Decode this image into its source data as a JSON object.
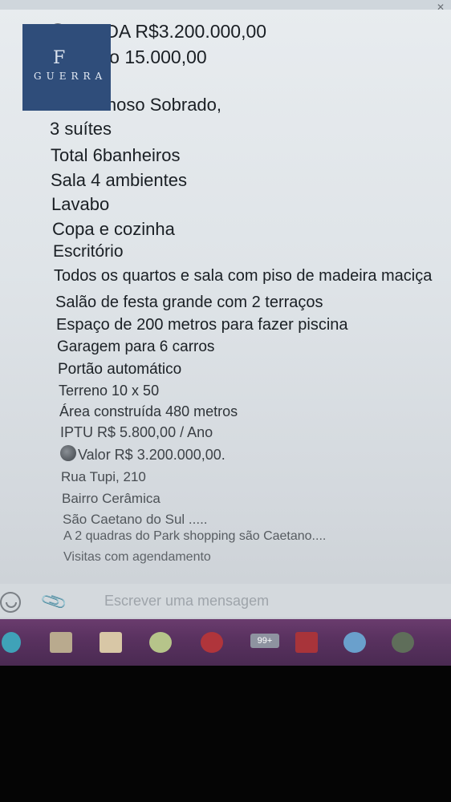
{
  "brand": {
    "logo_text": "GUERRA",
    "logo_mark": "F"
  },
  "message": {
    "lines": [
      "VENDA R$3.200.000,00",
      "Locação 15.000,00",
      "Maravilhoso Sobrado,",
      "3 suítes",
      "Total 6banheiros",
      "Sala 4 ambientes",
      "Lavabo",
      "Copa e cozinha",
      "Escritório",
      "Todos os quartos e sala com piso de madeira maciça",
      "Salão de festa grande com 2 terraços",
      "Espaço de 200 metros para fazer piscina",
      "Garagem para 6 carros",
      "Portão automático",
      "Terreno 10 x 50",
      "Área construída 480 metros",
      "IPTU R$ 5.800,00 / Ano",
      "Valor R$ 3.200.000,00.",
      "Rua Tupi, 210",
      "Bairro Cerâmica",
      "São Caetano do Sul .....",
      "A 2 quadras do Park shopping são Caetano....",
      "Visitas com agendamento"
    ]
  },
  "composer": {
    "placeholder": "Escrever uma mensagem"
  },
  "taskbar": {
    "badge": "99+"
  },
  "icons": {
    "emoji": "smile-icon",
    "attach": "paperclip-icon",
    "bullet": "money-bag-icon"
  },
  "colors": {
    "taskbar": "#5a3260",
    "logo_bg": "#2f4d7a"
  }
}
